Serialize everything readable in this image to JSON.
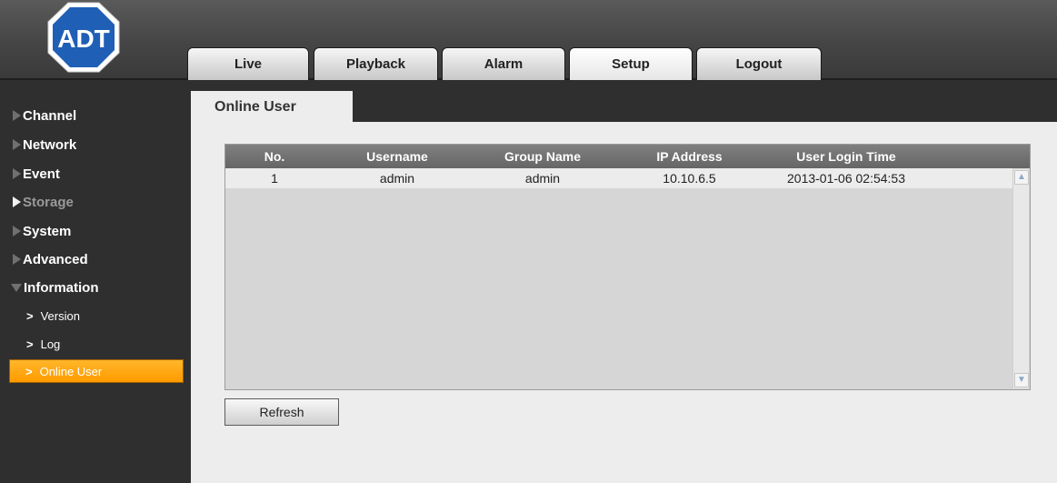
{
  "brand": {
    "logo_text": "ADT",
    "colors": {
      "logo_blue": "#1f5fb5",
      "accent_orange": "#ff9b00"
    }
  },
  "nav": {
    "tabs": [
      "Live",
      "Playback",
      "Alarm",
      "Setup",
      "Logout"
    ],
    "active": "Setup"
  },
  "sidebar": {
    "items": [
      "Channel",
      "Network",
      "Event",
      "Storage",
      "System",
      "Advanced",
      "Information"
    ],
    "sub_items": [
      "Version",
      "Log",
      "Online User"
    ],
    "sub_prefix": ">",
    "active_sub": "Online User"
  },
  "section": {
    "title": "Online User"
  },
  "table": {
    "headers": [
      "No.",
      "Username",
      "Group Name",
      "IP Address",
      "User Login Time"
    ],
    "rows": [
      [
        "1",
        "admin",
        "admin",
        "10.10.6.5",
        "2013-01-06 02:54:53"
      ]
    ]
  },
  "actions": {
    "refresh_label": "Refresh"
  },
  "icons": {
    "scroll_up": "chevron-up-icon",
    "scroll_down": "chevron-down-icon"
  }
}
